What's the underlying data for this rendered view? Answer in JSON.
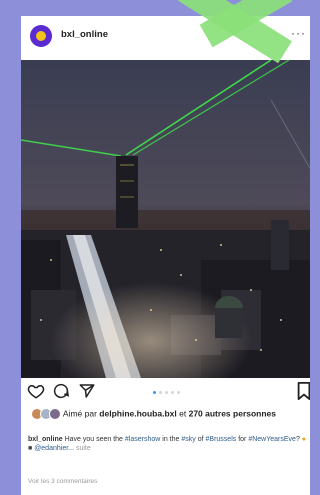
{
  "post": {
    "username": "bxl_online",
    "more_label": "···",
    "likes": {
      "prefix": "Aimé par",
      "user": "delphine.houba.bxl",
      "middle": "et",
      "count": "270 autres",
      "suffix": "personnes"
    },
    "caption": {
      "author": "bxl_online",
      "text1": "Have you seen the",
      "tag1": "#lasershow",
      "text2": "in the",
      "tag2": "#sky",
      "text3": "of",
      "tag3": "#Brussels",
      "text4": "for",
      "tag4": "#NewYearsEve",
      "text5": "?",
      "mention": "@edanhier...",
      "more": "suite"
    },
    "comments_link": "Voir les 3 commentaires"
  },
  "icons": [
    "heart-icon",
    "comment-icon",
    "share-icon",
    "bookmark-icon",
    "more-icon"
  ],
  "colors": {
    "background": "#8d8fd8",
    "tape": "#8be07a",
    "laser": "#3fe64a",
    "link": "#2f5b8a",
    "carousel_active": "#3b96f0"
  },
  "carousel": {
    "count": 5,
    "active": 1
  }
}
